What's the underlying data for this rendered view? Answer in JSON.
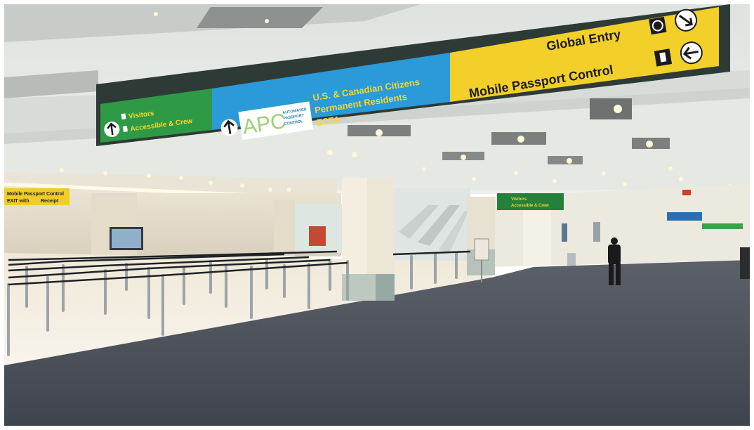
{
  "scene": {
    "description_colors": {
      "sign_green": "#2e9a45",
      "sign_blue": "#2a9ad8",
      "sign_yellow": "#f3cf2a",
      "carpet": "#4f5560",
      "ceiling": "#e9ece9",
      "floor_tile": "#f2eee4"
    }
  },
  "main_sign": {
    "green_panel": {
      "line1": "Visitors",
      "line2": "Accessible & Crew",
      "arrow": "up-arrow-icon"
    },
    "blue_panel": {
      "logo_text": "APC",
      "logo_sub1": "AUTOMATED",
      "logo_sub2": "PASSPORT",
      "logo_sub3": "CONTROL",
      "line1": "U.S. & Canadian Citizens",
      "line2": "Permanent Residents",
      "line3": "ESTA",
      "arrow": "up-arrow-icon"
    },
    "yellow_panel": {
      "line1": "Global Entry",
      "line2": "Mobile Passport Control",
      "arrow1": "right-down-arrow-icon",
      "arrow2": "left-arrow-icon"
    }
  },
  "left_sign": {
    "line1": "Mobile Passport Control",
    "line2": "EXIT with",
    "line3": "Receipt"
  },
  "mid_sign": {
    "line1": "Visitors",
    "line2": "Accessible & Crew"
  }
}
